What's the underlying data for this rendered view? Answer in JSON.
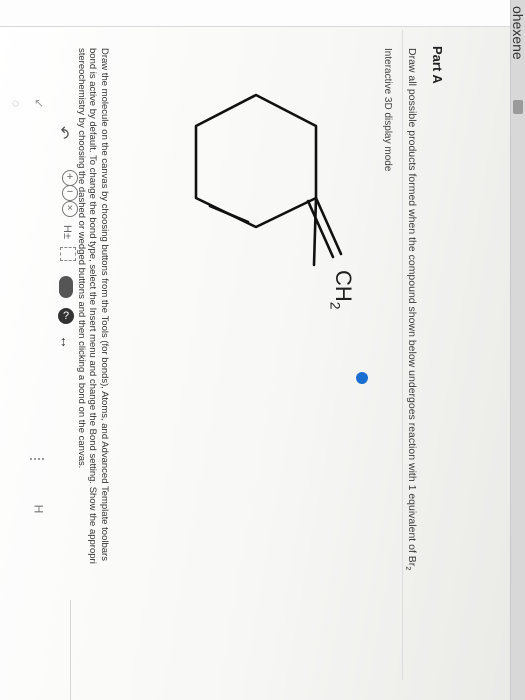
{
  "window": {
    "title_fragment": "ohexene"
  },
  "part": {
    "label": "Part A"
  },
  "question": {
    "text": "Draw all possible products formed when the compound shown below undergoes reaction with 1 equivalent of Br",
    "subscript": "2"
  },
  "display_mode": {
    "label": "Interactive 3D display mode"
  },
  "molecule": {
    "group_label": "CH",
    "group_subscript": "2"
  },
  "instructions": [
    "Draw the molecule on the canvas by choosing buttons from the Tools (for bonds), Atoms, and Advanced Template toolbars",
    "bond is active by default. To change the bond type, select the Insert menu and change the Bond setting. Show the appropri",
    "stereochemistry by choosing the dashed or wedged buttons and then clicking a bond on the canvas."
  ],
  "toolbar": {
    "hplus_label": "H±",
    "help_label": "?",
    "h_label": "H"
  },
  "colors": {
    "info_blue": "#1a6fd1",
    "toolbar_dark": "#333333",
    "icon_gray": "#888888"
  }
}
